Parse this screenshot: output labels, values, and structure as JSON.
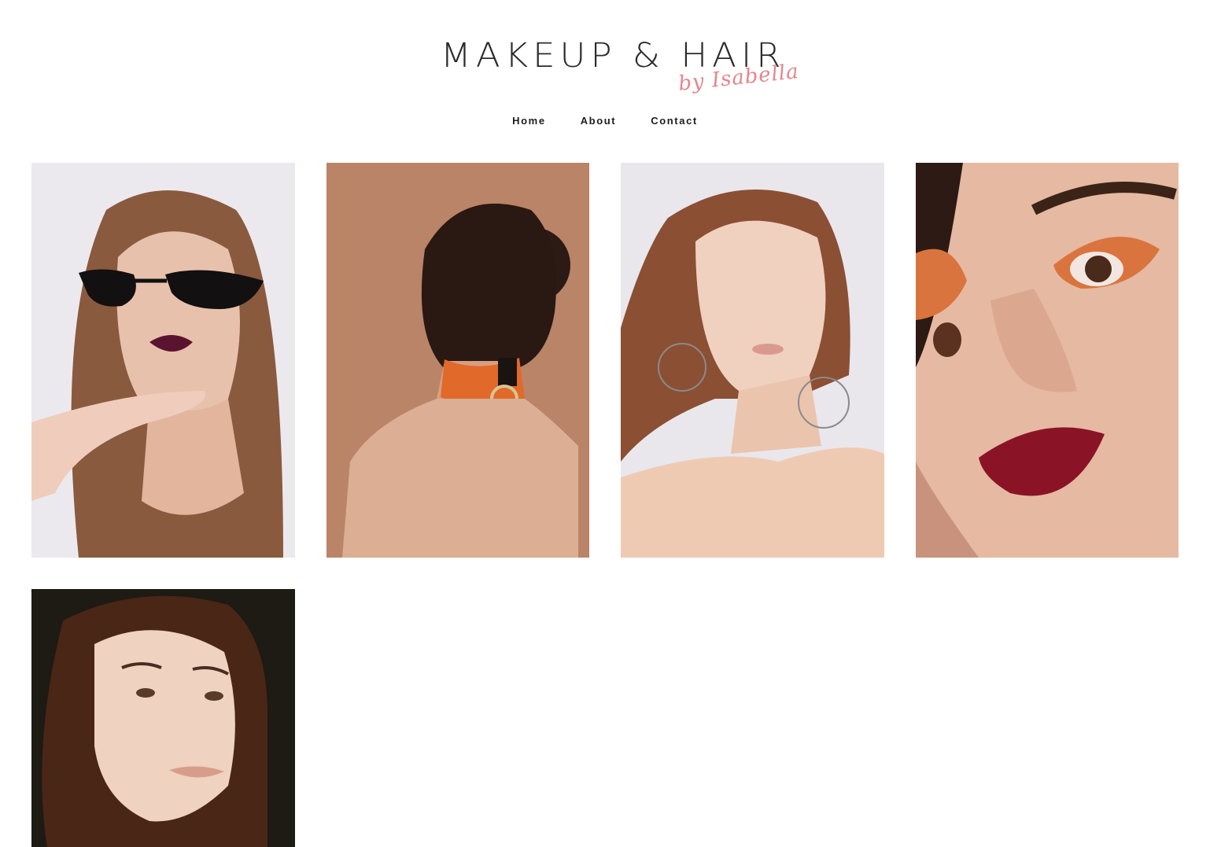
{
  "site": {
    "logo_main": "MAKEUP & HAIR",
    "logo_script": "by Isabella",
    "accent_color": "#e6848c"
  },
  "nav": {
    "items": [
      {
        "label": "Home"
      },
      {
        "label": "About"
      },
      {
        "label": "Contact"
      }
    ]
  },
  "gallery": {
    "photos": [
      {
        "subject": "portrait-cat-eye-sunglasses-plum-lips",
        "background": "#ece9ee"
      },
      {
        "subject": "back-view-hair-bun-orange-collar",
        "background": "#b98468"
      },
      {
        "subject": "portrait-wire-face-hoop-earrings",
        "background": "#e9e7ec"
      },
      {
        "subject": "closeup-orange-eyeshadow-red-lips",
        "background": "#c8927c"
      },
      {
        "subject": "portrait-natural-makeup-dark-background",
        "background": "#1e1a14"
      }
    ]
  }
}
